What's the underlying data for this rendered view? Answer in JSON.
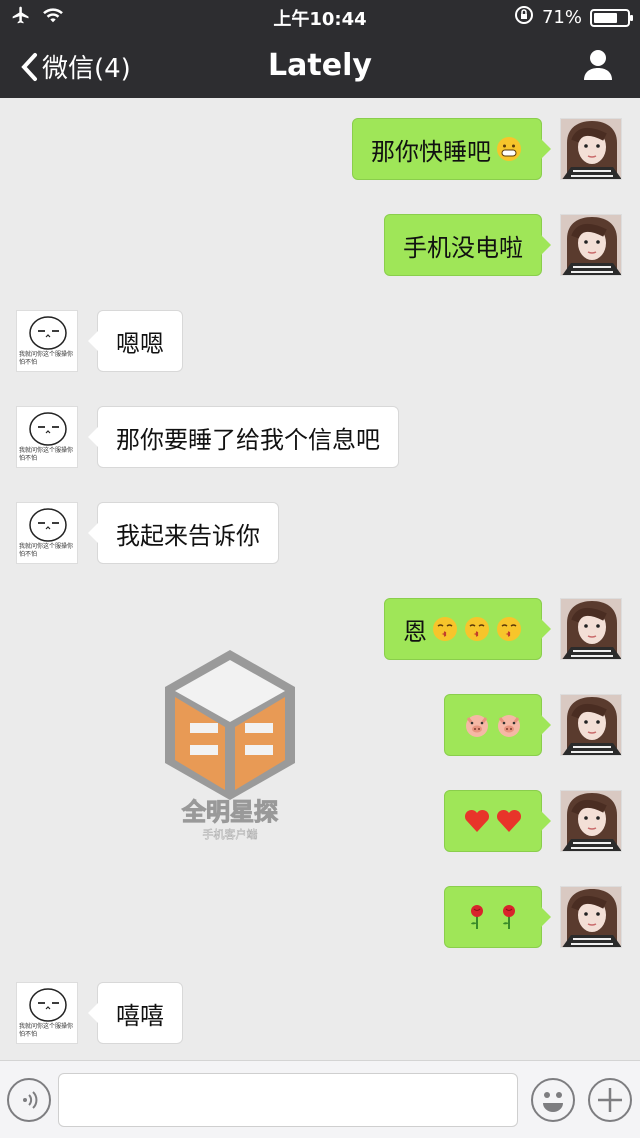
{
  "status_bar": {
    "time": "上午10:44",
    "battery_percent": "71%",
    "battery_level": 0.71
  },
  "nav": {
    "back_label": "微信(4)",
    "title": "Lately"
  },
  "messages": [
    {
      "side": "sent",
      "text": "那你快睡吧",
      "emojis": [
        "grin-emoji"
      ]
    },
    {
      "side": "sent",
      "text": "手机没电啦",
      "emojis": []
    },
    {
      "side": "recv",
      "text": "嗯嗯",
      "emojis": []
    },
    {
      "side": "recv",
      "text": "那你要睡了给我个信息吧",
      "emojis": []
    },
    {
      "side": "recv",
      "text": "我起来告诉你",
      "emojis": []
    },
    {
      "side": "sent",
      "text": "恩",
      "emojis": [
        "kiss-emoji",
        "kiss-emoji",
        "kiss-emoji"
      ]
    },
    {
      "side": "sent",
      "text": "",
      "emojis": [
        "pig-emoji",
        "pig-emoji"
      ]
    },
    {
      "side": "sent",
      "text": "",
      "emojis": [
        "heart-emoji",
        "heart-emoji"
      ]
    },
    {
      "side": "sent",
      "text": "",
      "emojis": [
        "rose-emoji",
        "rose-emoji"
      ]
    },
    {
      "side": "recv",
      "text": "嘻嘻",
      "emojis": []
    }
  ],
  "avatar_caption": "我就问你这个服操你怕不怕",
  "watermark": {
    "title": "全明星探",
    "subtitle": "手机客户端"
  },
  "input": {
    "value": ""
  },
  "colors": {
    "sent_bubble": "#9fe658",
    "recv_bubble": "#ffffff",
    "topbar": "#2d2d30",
    "background": "#ebebeb"
  }
}
